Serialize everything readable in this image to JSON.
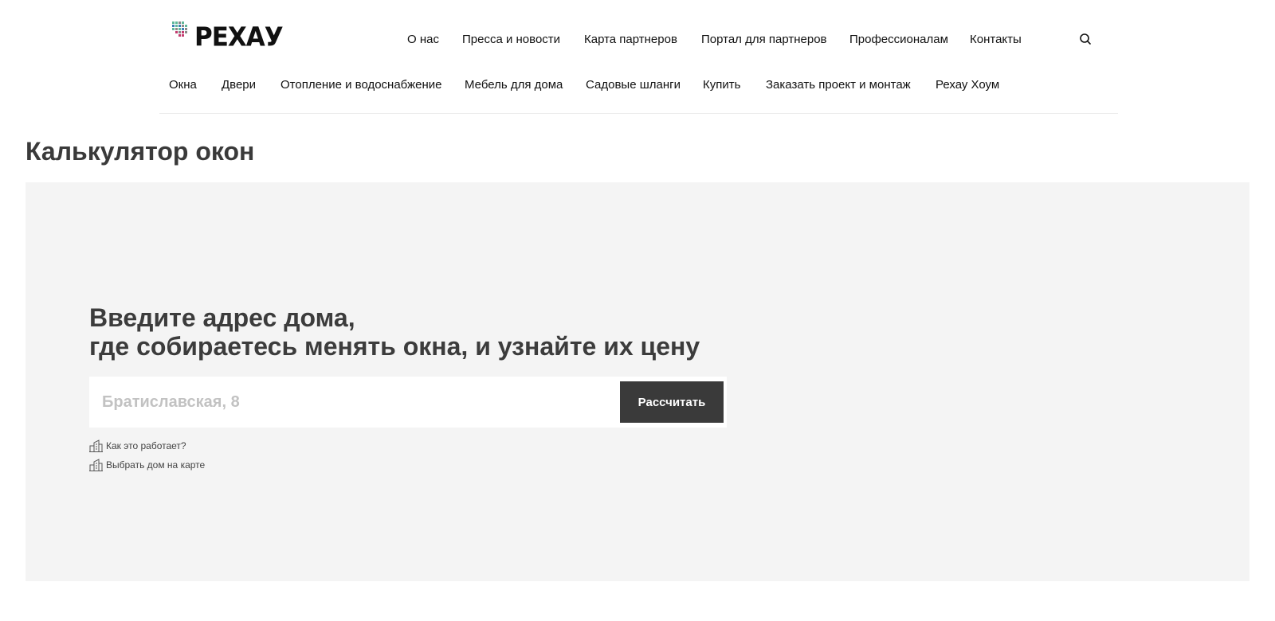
{
  "header": {
    "logo_text": "РЕХАУ",
    "top_nav": [
      {
        "label": "О нас"
      },
      {
        "label": "Пресса и новости"
      },
      {
        "label": "Карта партнеров"
      },
      {
        "label": "Портал для партнеров"
      },
      {
        "label": "Профессионалам"
      },
      {
        "label": "Контакты"
      }
    ],
    "search_icon": "search-icon",
    "main_nav": [
      {
        "label": "Окна"
      },
      {
        "label": "Двери"
      },
      {
        "label": "Отопление и водоснабжение"
      },
      {
        "label": "Мебель для дома"
      },
      {
        "label": "Садовые шланги"
      },
      {
        "label": "Купить"
      },
      {
        "label": "Заказать проект и монтаж"
      },
      {
        "label": "Рехау Хоум"
      }
    ]
  },
  "page": {
    "title": "Калькулятор окон"
  },
  "calculator": {
    "headline_line1": "Введите адрес дома,",
    "headline_line2": "где собираетесь менять окна, и узнайте их цену",
    "address_placeholder": "Братиславская, 8",
    "address_value": "",
    "button_label": "Рассчитать",
    "links": [
      {
        "label": "Как это работает?",
        "icon": "building-icon"
      },
      {
        "label": "Выбрать дом на карте",
        "icon": "building-icon"
      }
    ]
  },
  "colors": {
    "panel_bg": "#f4f4f4",
    "button_bg": "#3a3a3a",
    "heading": "#3c3c3c",
    "logo_dots": [
      "#4caf8a",
      "#2f6fa8",
      "#c23b6e",
      "#888888"
    ]
  }
}
